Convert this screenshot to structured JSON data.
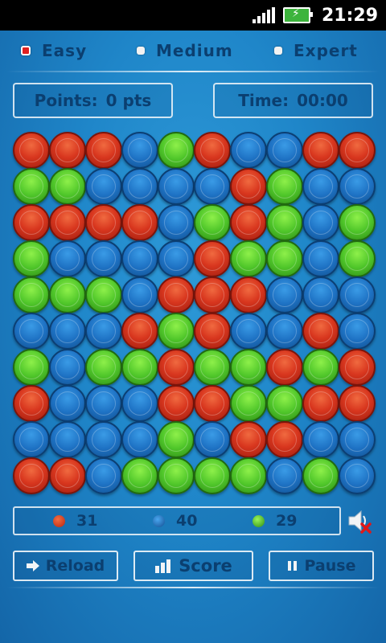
{
  "status_bar": {
    "time": "21:29"
  },
  "difficulty": [
    {
      "label": "Easy",
      "selected": true
    },
    {
      "label": "Medium",
      "selected": false
    },
    {
      "label": "Expert",
      "selected": false
    }
  ],
  "points": {
    "label": "Points:",
    "value": "0 pts"
  },
  "time": {
    "label": "Time:",
    "value": "00:00"
  },
  "board": {
    "rows": 10,
    "cols": 10,
    "grid": [
      [
        "red",
        "red",
        "red",
        "blue",
        "green",
        "red",
        "blue",
        "blue",
        "red",
        "red"
      ],
      [
        "green",
        "green",
        "blue",
        "blue",
        "blue",
        "blue",
        "red",
        "green",
        "blue",
        "blue"
      ],
      [
        "red",
        "red",
        "red",
        "red",
        "blue",
        "green",
        "red",
        "green",
        "blue",
        "green"
      ],
      [
        "green",
        "blue",
        "blue",
        "blue",
        "blue",
        "red",
        "green",
        "green",
        "blue",
        "green"
      ],
      [
        "green",
        "green",
        "green",
        "blue",
        "red",
        "red",
        "red",
        "blue",
        "blue",
        "blue"
      ],
      [
        "blue",
        "blue",
        "blue",
        "red",
        "green",
        "red",
        "blue",
        "blue",
        "red",
        "blue"
      ],
      [
        "green",
        "blue",
        "green",
        "green",
        "red",
        "green",
        "green",
        "red",
        "green",
        "red"
      ],
      [
        "red",
        "blue",
        "blue",
        "blue",
        "red",
        "red",
        "green",
        "green",
        "red",
        "red"
      ],
      [
        "blue",
        "blue",
        "blue",
        "blue",
        "green",
        "blue",
        "red",
        "red",
        "blue",
        "blue"
      ],
      [
        "red",
        "red",
        "blue",
        "green",
        "green",
        "green",
        "green",
        "blue",
        "green",
        "blue"
      ]
    ]
  },
  "counts": [
    {
      "color": "red",
      "value": "31"
    },
    {
      "color": "blue",
      "value": "40"
    },
    {
      "color": "green",
      "value": "29"
    }
  ],
  "sound": {
    "icon": "speaker-muted-icon",
    "muted": true
  },
  "buttons": {
    "reload": "Reload",
    "score": "Score",
    "pause": "Pause"
  },
  "colors": {
    "red": "#d8361e",
    "blue": "#1e72c4",
    "green": "#4fc62a",
    "text": "#0b3f70"
  }
}
